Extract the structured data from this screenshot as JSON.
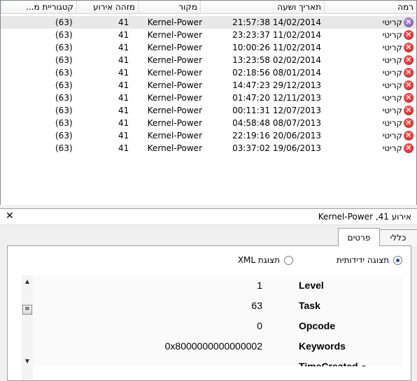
{
  "events": {
    "columns": {
      "level": "רמה",
      "datetime": "תאריך ושעה",
      "source": "מקור",
      "event_id": "מזהה אירוע",
      "category": "קטגוריית מ..."
    },
    "rows": [
      {
        "level": "קריטי",
        "datetime": "14/02/2014 21:57:38",
        "source": "Kernel-Power",
        "event_id": "41",
        "category": "(63)",
        "selected": true
      },
      {
        "level": "קריטי",
        "datetime": "11/02/2014 23:23:37",
        "source": "Kernel-Power",
        "event_id": "41",
        "category": "(63)"
      },
      {
        "level": "קריטי",
        "datetime": "11/02/2014 10:00:26",
        "source": "Kernel-Power",
        "event_id": "41",
        "category": "(63)"
      },
      {
        "level": "קריטי",
        "datetime": "02/02/2014 13:23:58",
        "source": "Kernel-Power",
        "event_id": "41",
        "category": "(63)"
      },
      {
        "level": "קריטי",
        "datetime": "08/01/2014 02:18:56",
        "source": "Kernel-Power",
        "event_id": "41",
        "category": "(63)"
      },
      {
        "level": "קריטי",
        "datetime": "29/12/2013 14:47:23",
        "source": "Kernel-Power",
        "event_id": "41",
        "category": "(63)"
      },
      {
        "level": "קריטי",
        "datetime": "12/11/2013 01:47:20",
        "source": "Kernel-Power",
        "event_id": "41",
        "category": "(63)"
      },
      {
        "level": "קריטי",
        "datetime": "12/07/2013 00:11:31",
        "source": "Kernel-Power",
        "event_id": "41",
        "category": "(63)"
      },
      {
        "level": "קריטי",
        "datetime": "08/07/2013 04:58:48",
        "source": "Kernel-Power",
        "event_id": "41",
        "category": "(63)"
      },
      {
        "level": "קריטי",
        "datetime": "20/06/2013 22:19:16",
        "source": "Kernel-Power",
        "event_id": "41",
        "category": "(63)"
      },
      {
        "level": "קריטי",
        "datetime": "19/06/2013 03:37:02",
        "source": "Kernel-Power",
        "event_id": "41",
        "category": "(63)"
      }
    ]
  },
  "detail": {
    "title": "אירוע 41, Kernel-Power",
    "close_glyph": "✕",
    "tabs": {
      "general": "כללי",
      "details": "פרטים"
    },
    "radio": {
      "friendly": "תצוגה ידידותית",
      "xml": "תצוגת XML"
    },
    "properties": [
      {
        "key": "Level",
        "value": "1"
      },
      {
        "key": "Task",
        "value": "63"
      },
      {
        "key": "Opcode",
        "value": "0"
      },
      {
        "key": "Keywords",
        "value": "0x8000000000000002"
      },
      {
        "key": "TimeCreated",
        "value": ""
      }
    ],
    "collapse_glyph": "-"
  },
  "icons": {
    "error": "error-icon",
    "close": "close-icon",
    "scroll_up": "scroll-up-arrow",
    "scroll_down": "scroll-down-arrow"
  }
}
